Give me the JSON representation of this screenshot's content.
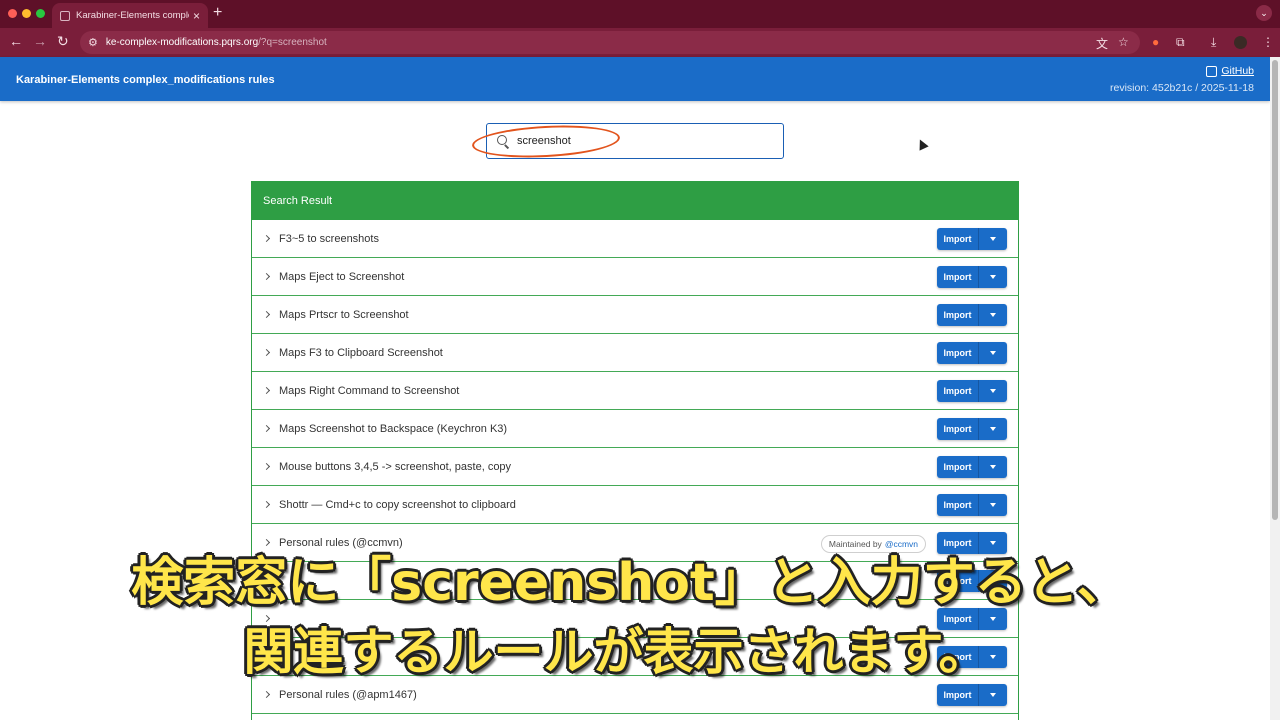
{
  "browser": {
    "tab_title": "Karabiner-Elements complex",
    "tab_close": "×",
    "new_tab": "+",
    "tab_menu": "⌄",
    "url_host": "ke-complex-modifications.pqrs.org",
    "url_path": "/?q=screenshot",
    "back": "←",
    "forward": "→",
    "reload": "↻",
    "tune": "⚙",
    "translate_icon": "文",
    "bookmark_icon": "☆",
    "extension_icon": "⧉",
    "download_icon": "⤓",
    "menu_icon": "⋮"
  },
  "app": {
    "title": "Karabiner-Elements complex_modifications rules",
    "github_label": "GitHub",
    "revision": "revision: 452b21c / 2025-11-18"
  },
  "search": {
    "value": "screenshot"
  },
  "results": {
    "header": "Search Result",
    "import_label": "Import",
    "rows": [
      {
        "label": "F3~5 to screenshots"
      },
      {
        "label": "Maps Eject to Screenshot"
      },
      {
        "label": "Maps Prtscr to Screenshot"
      },
      {
        "label": "Maps F3 to Clipboard Screenshot"
      },
      {
        "label": "Maps Right Command to Screenshot"
      },
      {
        "label": "Maps Screenshot to Backspace (Keychron K3)"
      },
      {
        "label": "Mouse buttons 3,4,5 -> screenshot, paste, copy"
      },
      {
        "label": "Shottr — Cmd+c to copy screenshot to clipboard"
      },
      {
        "label": "Personal rules (@ccmvn)",
        "badge_prefix": "Maintained by",
        "badge_user": "@ccmvn"
      },
      {
        "label": ""
      },
      {
        "label": ""
      },
      {
        "label": ""
      },
      {
        "label": "Personal rules (@apm1467)"
      }
    ]
  },
  "captions": {
    "line1": "検索窓に「screenshot」と入力すると、",
    "line2": "関連するルールが表示されます。"
  }
}
